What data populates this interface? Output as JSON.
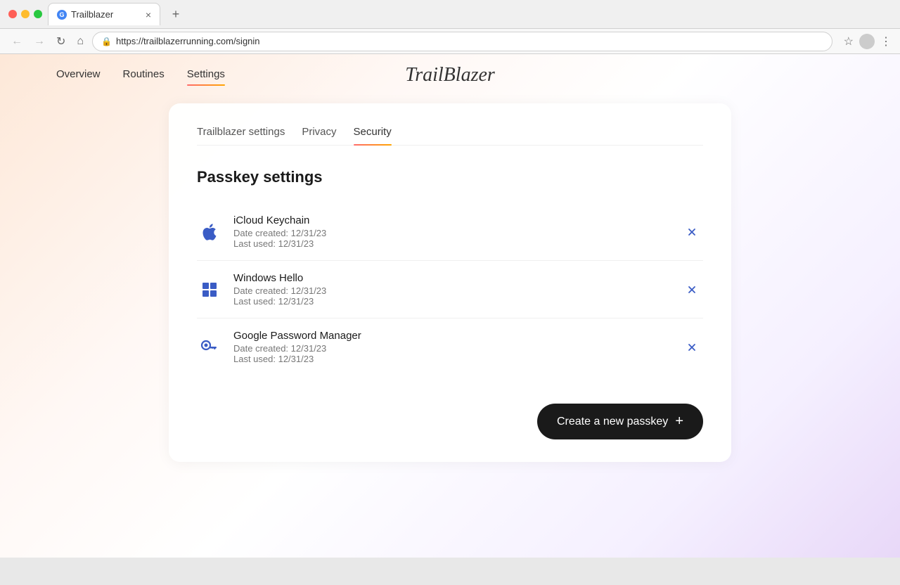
{
  "browser": {
    "tab_title": "Trailblazer",
    "tab_close": "×",
    "new_tab": "+",
    "address": "https://trailblazerrunning.com/signin",
    "nav_back": "←",
    "nav_forward": "→",
    "nav_refresh": "↻",
    "nav_home": "⌂"
  },
  "topnav": {
    "links": [
      {
        "label": "Overview",
        "active": false
      },
      {
        "label": "Routines",
        "active": false
      },
      {
        "label": "Settings",
        "active": true
      }
    ],
    "logo": "TrailBlazer"
  },
  "settings": {
    "tabs": [
      {
        "label": "Trailblazer settings",
        "active": false
      },
      {
        "label": "Privacy",
        "active": false
      },
      {
        "label": "Security",
        "active": true
      }
    ],
    "section_title": "Passkey settings",
    "passkeys": [
      {
        "name": "iCloud Keychain",
        "date_created": "Date created: 12/31/23",
        "last_used": "Last used: 12/31/23",
        "icon_type": "apple"
      },
      {
        "name": "Windows Hello",
        "date_created": "Date created: 12/31/23",
        "last_used": "Last used: 12/31/23",
        "icon_type": "windows"
      },
      {
        "name": "Google Password Manager",
        "date_created": "Date created: 12/31/23",
        "last_used": "Last used: 12/31/23",
        "icon_type": "key"
      }
    ],
    "create_button": "Create a new passkey"
  }
}
